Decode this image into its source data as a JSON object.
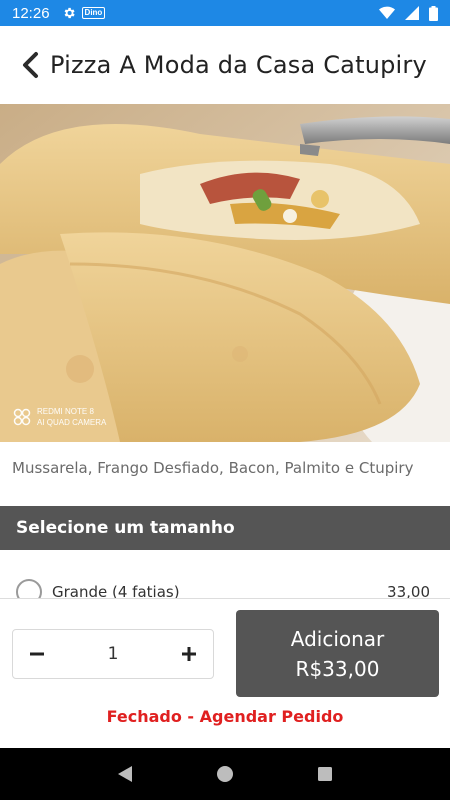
{
  "status_bar": {
    "time": "12:26",
    "icons": [
      "gear-icon",
      "dino-tag",
      "wifi-icon",
      "signal-icon",
      "battery-icon"
    ],
    "tag_text": "Dino"
  },
  "header": {
    "title": "Pizza A Moda da Casa Catupiry",
    "back_icon": "chevron-left-icon"
  },
  "photo": {
    "watermark_line1": "REDMI NOTE 8",
    "watermark_line2": "AI QUAD CAMERA"
  },
  "product": {
    "description": "Mussarela, Frango Desfiado, Bacon, Palmito e Ctupiry"
  },
  "size_section": {
    "title": "Selecione um tamanho",
    "options": [
      {
        "label": "Grande (4 fatias)",
        "price": "33,00"
      }
    ]
  },
  "cart": {
    "quantity": "1",
    "minus_icon": "minus-icon",
    "plus_icon": "plus-icon",
    "add_label": "Adicionar",
    "add_price": "R$33,00",
    "closed_message": "Fechado - Agendar Pedido"
  },
  "colors": {
    "status_bar": "#1e88e5",
    "section_header": "#555555",
    "add_button": "#555555",
    "closed_text": "#e02020"
  },
  "nav_bar": {
    "icons": [
      "back-triangle-icon",
      "home-circle-icon",
      "recents-square-icon"
    ]
  }
}
